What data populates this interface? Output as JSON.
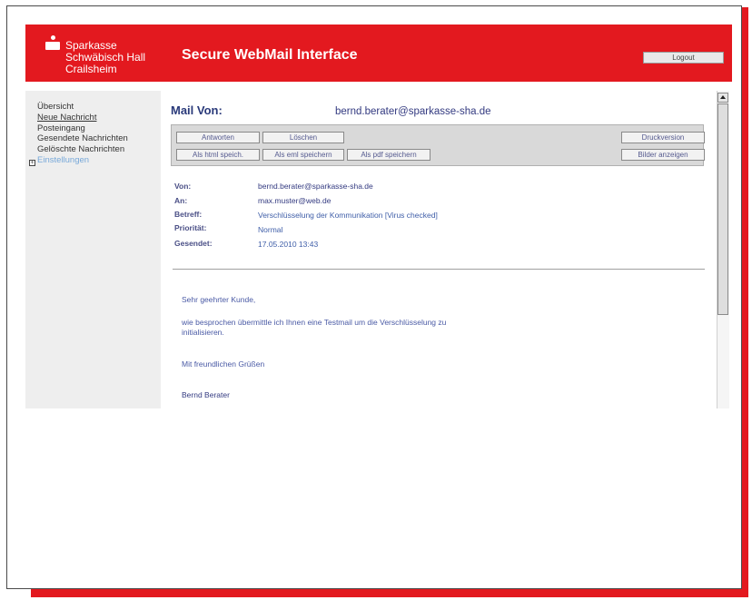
{
  "bank": {
    "line1": "Sparkasse",
    "line2": "Schwäbisch Hall",
    "line3": "Crailsheim"
  },
  "header": {
    "title": "Secure WebMail Interface",
    "logout": "Logout"
  },
  "sidebar": {
    "items": [
      {
        "label": "Übersicht"
      },
      {
        "label": "Neue Nachricht"
      },
      {
        "label": "Posteingang"
      },
      {
        "label": "Gesendete Nachrichten"
      },
      {
        "label": "Gelöschte Nachrichten"
      },
      {
        "label": "Einstellungen"
      }
    ],
    "expand_symbol": "+"
  },
  "mail": {
    "from_title": "Mail Von:",
    "from_address": "bernd.berater@sparkasse-sha.de",
    "toolbar": {
      "reply": "Antworten",
      "delete": "Löschen",
      "print": "Druckversion",
      "save_html": "Als html speich.",
      "save_eml": "Als eml speichern",
      "save_pdf": "Als pdf speichern",
      "show_images": "Bilder anzeigen"
    },
    "fields": [
      {
        "label": "Von:",
        "value": "bernd.berater@sparkasse-sha.de"
      },
      {
        "label": "An:",
        "value": "max.muster@web.de"
      },
      {
        "label": "Betreff:",
        "value": "Verschlüsselung der Kommunikation [Virus checked]"
      },
      {
        "label": "Priorität:",
        "value": "Normal"
      },
      {
        "label": "Gesendet:",
        "value": "17.05.2010 13:43"
      }
    ],
    "body": {
      "greeting": "Sehr geehrter Kunde,",
      "line1": "wie besprochen übermittle ich Ihnen eine Testmail um die Verschlüsselung zu",
      "line2": "initialisieren.",
      "closing": "Mit freundlichen Grüßen",
      "signature": "Bernd Berater"
    }
  },
  "colors": {
    "brand": "#e3191f",
    "link": "#77a8d9",
    "text_blue": "#333a80"
  }
}
